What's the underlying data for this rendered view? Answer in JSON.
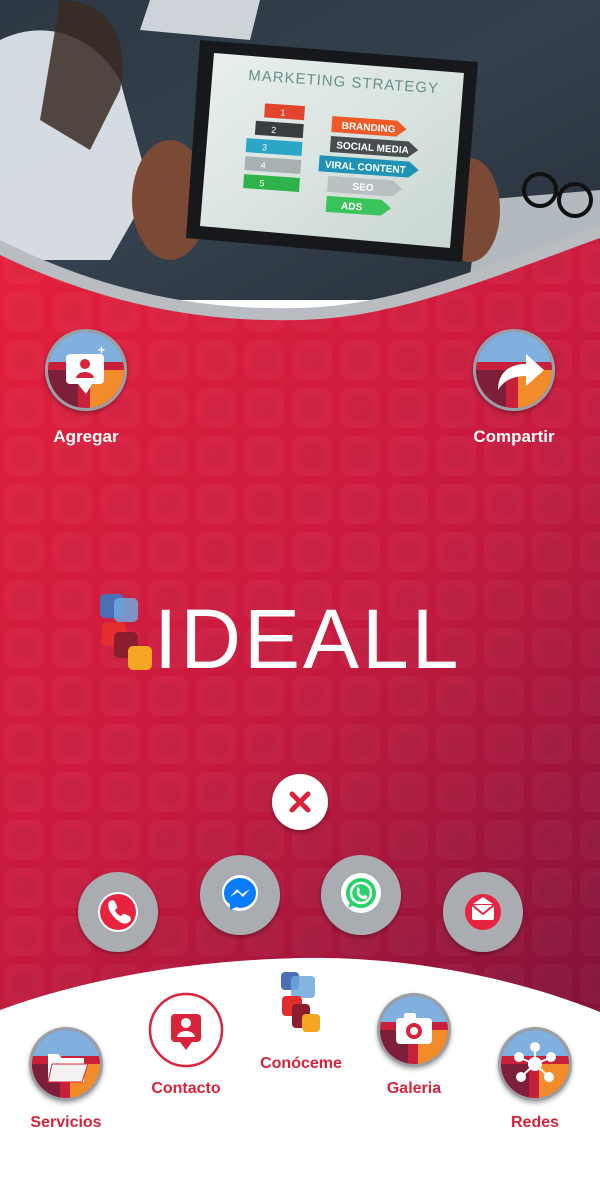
{
  "hero": {
    "tablet_title": "MARKETING STRATEGY",
    "steps": [
      {
        "number": "1",
        "label": "BRANDING"
      },
      {
        "number": "2",
        "label": "SOCIAL MEDIA"
      },
      {
        "number": "3",
        "label": "VIRAL CONTENT"
      },
      {
        "number": "4",
        "label": "SEO"
      },
      {
        "number": "5",
        "label": "ADS"
      }
    ]
  },
  "actions": {
    "add_label": "Agregar",
    "share_label": "Compartir"
  },
  "brand": {
    "name": "IDEALL"
  },
  "contact_menu": {
    "close": "close-icon",
    "items": [
      "phone-icon",
      "messenger-icon",
      "whatsapp-icon",
      "email-icon"
    ]
  },
  "bottom_nav": {
    "services_label": "Servicios",
    "contact_label": "Contacto",
    "about_label": "Conóceme",
    "gallery_label": "Galeria",
    "social_label": "Redes"
  },
  "colors": {
    "primary_red": "#e21f3a",
    "dark_red": "#8a1238",
    "label_red": "#d8233a",
    "whatsapp_green": "#25d366",
    "messenger_blue": "#0a7cff"
  }
}
